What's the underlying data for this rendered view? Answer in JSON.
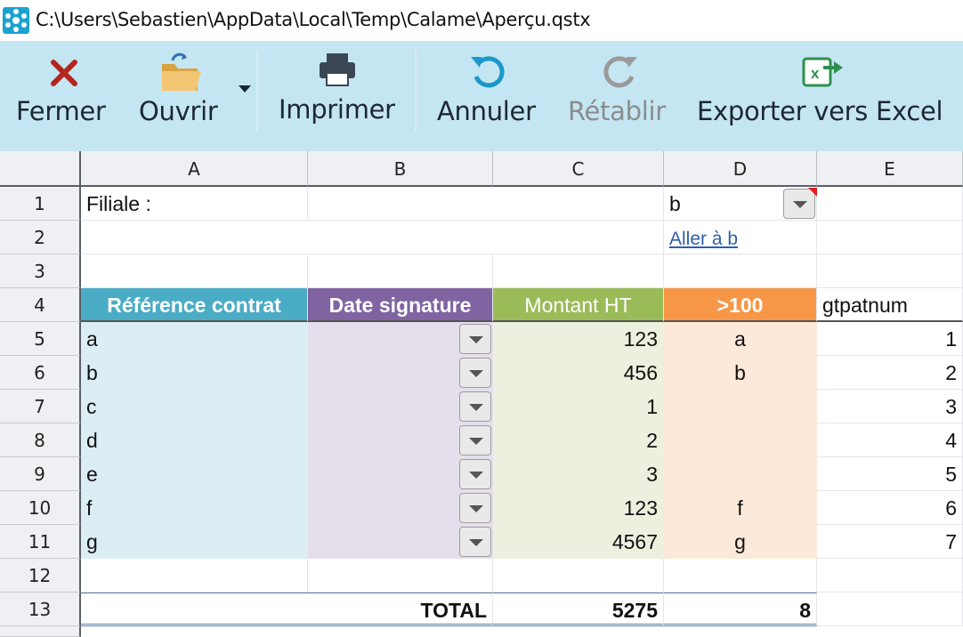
{
  "window": {
    "title": "C:\\Users\\Sebastien\\AppData\\Local\\Temp\\Calame\\Aperçu.qstx"
  },
  "toolbar": {
    "close_label": "Fermer",
    "open_label": "Ouvrir",
    "print_label": "Imprimer",
    "undo_label": "Annuler",
    "redo_label": "Rétablir",
    "export_label": "Exporter vers Excel"
  },
  "columns": [
    "A",
    "B",
    "C",
    "D",
    "E"
  ],
  "rows": [
    "1",
    "2",
    "3",
    "4",
    "5",
    "6",
    "7",
    "8",
    "9",
    "10",
    "11",
    "12",
    "13"
  ],
  "sheet": {
    "filiale_label": "Filiale :",
    "filiale_value": "b",
    "goto_link": "Aller à b",
    "headers": {
      "ref": "Référence contrat",
      "date": "Date signature",
      "amount": "Montant HT",
      "gt100": ">100",
      "gtpatnum": "gtpatnum"
    },
    "data_rows": [
      {
        "ref": "a",
        "amount": "123",
        "gt100": "a",
        "num": "1"
      },
      {
        "ref": "b",
        "amount": "456",
        "gt100": "b",
        "num": "2"
      },
      {
        "ref": "c",
        "amount": "1",
        "gt100": "",
        "num": "3"
      },
      {
        "ref": "d",
        "amount": "2",
        "gt100": "",
        "num": "4"
      },
      {
        "ref": "e",
        "amount": "3",
        "gt100": "",
        "num": "5"
      },
      {
        "ref": "f",
        "amount": "123",
        "gt100": "f",
        "num": "6"
      },
      {
        "ref": "g",
        "amount": "4567",
        "gt100": "g",
        "num": "7"
      }
    ],
    "total_label": "TOTAL",
    "total_amount": "5275",
    "total_count": "8"
  },
  "colors": {
    "ribbon_bg": "#c4e6f2",
    "ref_header": "#4bacc6",
    "ref_fill": "#dbeef4",
    "date_header": "#8064a2",
    "date_fill": "#e5dfec",
    "amount_header": "#9bbb59",
    "amount_fill": "#ebf1de",
    "gt100_header": "#f79646",
    "gt100_fill": "#fde9d9",
    "comment_marker": "#e02020"
  }
}
